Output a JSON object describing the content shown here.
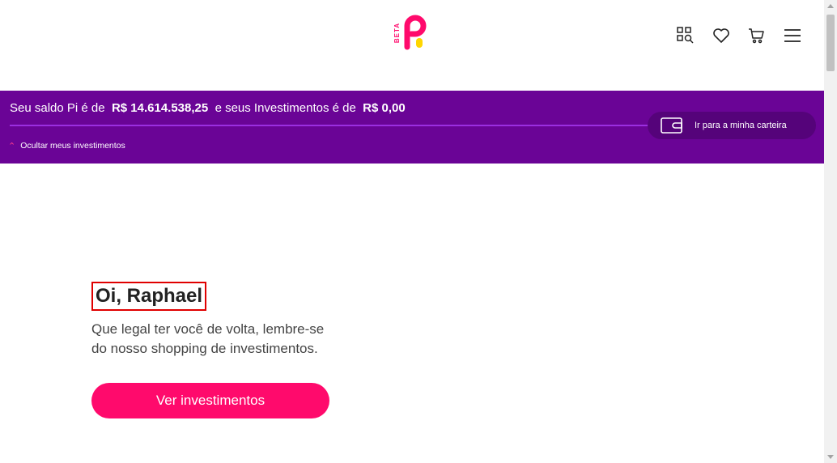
{
  "header": {
    "logo_badge": "BETA",
    "icons": [
      "search-products-icon",
      "heart-icon",
      "cart-icon",
      "menu-icon"
    ]
  },
  "balance": {
    "prefix": "Seu saldo Pi é de",
    "pi_amount": "R$ 14.614.538,25",
    "middle": "e seus Investimentos é de",
    "investments_amount": "R$ 0,00",
    "hide_label": "Ocultar meus investimentos",
    "wallet_button_label": "Ir para a minha carteira"
  },
  "main": {
    "greeting": "Oi, Raphael",
    "subtitle": "Que legal ter você de volta, lembre-se do nosso shopping de investimentos.",
    "cta_label": "Ver investimentos"
  },
  "colors": {
    "brand_pink": "#ff0a6c",
    "brand_purple": "#6a0496",
    "logo_yellow": "#ffd600"
  }
}
